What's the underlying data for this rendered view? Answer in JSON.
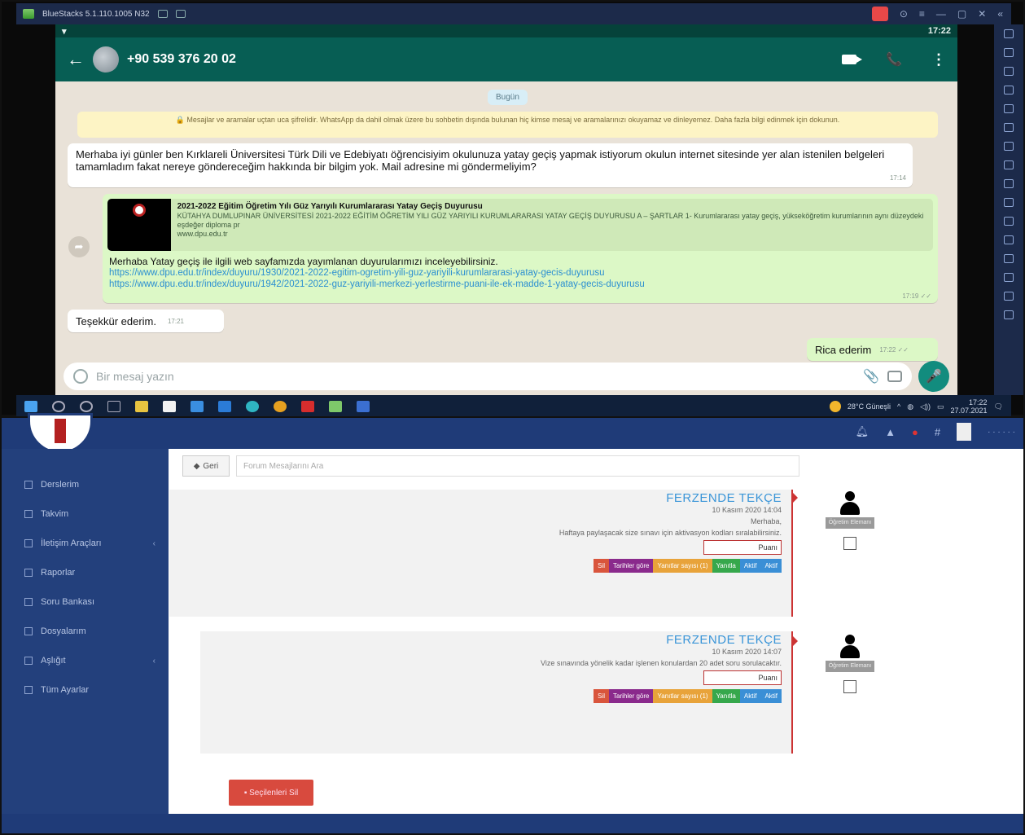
{
  "bluestacks": {
    "title": "BlueStacks 5.1.110.1005 N32"
  },
  "whatsapp": {
    "status_time": "17:22",
    "contact": "+90 539 376 20 02",
    "date_pill": "Bugün",
    "encryption_notice": "🔒 Mesajlar ve aramalar uçtan uca şifrelidir. WhatsApp da dahil olmak üzere bu sohbetin dışında bulunan hiç kimse mesaj ve aramalarınızı okuyamaz ve dinleyemez. Daha fazla bilgi edinmek için dokunun.",
    "messages": [
      {
        "text": "Merhaba iyi günler ben Kırklareli Üniversitesi Türk Dili ve Edebiyatı öğrencisiyim okulunuza yatay geçiş yapmak istiyorum okulun internet sitesinde yer alan istenilen belgeleri tamamladım fakat nereye göndereceğim hakkında bir bilgim yok. Mail adresine mi göndermeliyim?",
        "time": "17:14"
      },
      {
        "text": "Merhaba Yatay geçiş ile ilgili web sayfamızda yayımlanan duyurularımızı inceleyebilirsiniz.",
        "time": "17:19 ✓✓",
        "link_title": "2021-2022 Eğitim Öğretim Yılı Güz Yarıyılı Kurumlararası Yatay Geçiş Duyurusu",
        "link_desc": "KÜTAHYA DUMLUPINAR ÜNİVERSİTESİ 2021-2022 EĞİTİM ÖĞRETİM YILI GÜZ YARIYILI KURUMLARARASI YATAY GEÇİŞ DUYURUSU A – ŞARTLAR 1- Kurumlararası yatay geçiş, yükseköğretim kurumlarının aynı düzeydeki eşdeğer diploma pr",
        "link_domain": "www.dpu.edu.tr",
        "url1": "https://www.dpu.edu.tr/index/duyuru/1930/2021-2022-egitim-ogretim-yili-guz-yariyili-kurumlararasi-yatay-gecis-duyurusu",
        "url2": "https://www.dpu.edu.tr/index/duyuru/1942/2021-2022-guz-yariyili-merkezi-yerlestirme-puani-ile-ek-madde-1-yatay-gecis-duyurusu"
      },
      {
        "text": "Teşekkür ederim.",
        "time": "17:21"
      },
      {
        "text": "Rica ederim",
        "time": "17:22 ✓✓"
      }
    ],
    "input_placeholder": "Bir mesaj yazın"
  },
  "taskbar": {
    "weather": "28°C Güneşli",
    "clock_time": "17:22",
    "clock_date": "27.07.2021"
  },
  "lms": {
    "sidebar": [
      "Derslerim",
      "Takvim",
      "İletişim Araçları",
      "Raporlar",
      "Soru Bankası",
      "Dosyalarım",
      "Aşlığıt",
      "Tüm Ayarlar"
    ],
    "back_label": "Geri",
    "search_placeholder": "Forum Mesajlarını Ara",
    "posts": [
      {
        "author": "FERZENDE TEKÇE",
        "date": "10 Kasım 2020 14:04",
        "line1": "Merhaba,",
        "line2": "Haftaya paylaşacak size sınavı için aktivasyon kodları sıralabilirsiniz.",
        "points": "Puanı"
      },
      {
        "author": "FERZENDE TEKÇE",
        "date": "10 Kasım 2020 14:07",
        "line1": "Vize sınavında yönelik kadar işlenen konulardan 20 adet soru sorulacaktır.",
        "line2": "",
        "points": "Puanı"
      }
    ],
    "tags": [
      "Sil",
      "Tarihler göre",
      "Yanıtlar sayısı (1)",
      "Yanıtla",
      "Aktif",
      "Aktif"
    ],
    "role_label": "Öğretim Elemanı",
    "delete_label": "Seçilenleri Sil",
    "colors": {
      "sidebar": "#23407c",
      "accent": "#3a95d8",
      "delete": "#d84a3e"
    }
  }
}
